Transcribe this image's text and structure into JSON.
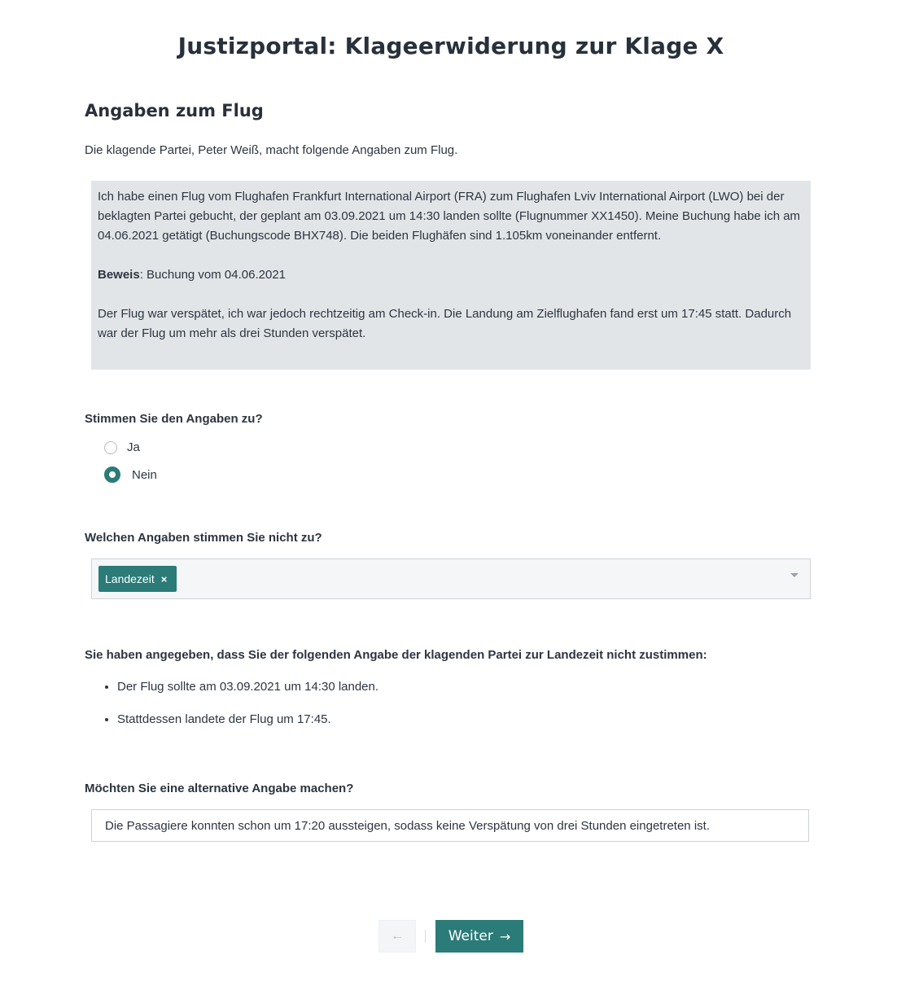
{
  "page_title": "Justizportal: Klageerwiderung zur Klage X",
  "section_title": "Angaben zum Flug",
  "intro_text": "Die klagende Partei, Peter Weiß, macht folgende Angaben zum Flug.",
  "claim": {
    "paragraph1": "Ich habe einen Flug vom Flughafen Frankfurt International Airport (FRA) zum Flughafen Lviv International Airport (LWO) bei der beklagten Partei gebucht, der geplant am 03.09.2021 um 14:30 landen sollte (Flugnummer XX1450). Meine Buchung habe ich am 04.06.2021 getätigt (Buchungscode BHX748). Die beiden Flughäfen sind 1.105km voneinander entfernt.",
    "evidence_label": "Beweis",
    "evidence_text": ": Buchung vom 04.06.2021",
    "paragraph3": "Der Flug war verspätet, ich war jedoch rechtzeitig am Check-in. Die Landung am Zielflughafen fand erst um 17:45 statt. Dadurch war der Flug um mehr als drei Stunden verspätet."
  },
  "agree_question": {
    "label": "Stimmen Sie den Angaben zu?",
    "options": [
      {
        "label": "Ja",
        "checked": false
      },
      {
        "label": "Nein",
        "checked": true
      }
    ]
  },
  "disagree_question": {
    "label": "Welchen Angaben stimmen Sie nicht zu?",
    "selected_chips": [
      "Landezeit"
    ],
    "chip_remove_glyph": "×"
  },
  "summary": {
    "label": "Sie haben angegeben, dass Sie der folgenden Angabe der klagenden Partei zur Landezeit nicht zustimmen:",
    "items": [
      "Der Flug sollte am 03.09.2021 um 14:30 landen.",
      "Stattdessen landete der Flug um 17:45."
    ]
  },
  "alternative_question": {
    "label": "Möchten Sie eine alternative Angabe machen?",
    "value": "Die Passagiere konnten schon um 17:20 aussteigen, sodass keine Verspätung von drei Stunden eingetreten ist."
  },
  "navigation": {
    "back_glyph": "←",
    "next_label": "Weiter",
    "next_glyph": "→"
  },
  "colors": {
    "accent": "#2b7b78",
    "claim_background": "#e2e5e8",
    "text": "#2d3540"
  }
}
